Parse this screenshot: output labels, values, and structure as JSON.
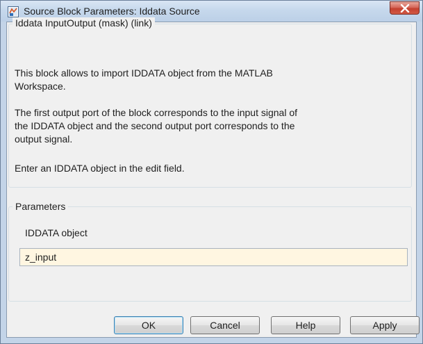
{
  "window": {
    "title": "Source Block Parameters: Iddata Source",
    "icon": "simulink-block-icon",
    "close_icon": "close-icon"
  },
  "description_group": {
    "legend": "Iddata InputOutput (mask) (link)",
    "lines": [
      "This block allows to import IDDATA object from the MATLAB",
      "Workspace.",
      "The first output port of the block corresponds to the input signal of",
      "the IDDATA object and the second output port corresponds to the",
      "output signal.",
      "Enter an IDDATA object in the edit field."
    ]
  },
  "parameters_group": {
    "legend": "Parameters",
    "field_label": "IDDATA object",
    "field_value": "z_input"
  },
  "buttons": {
    "ok": "OK",
    "cancel": "Cancel",
    "help": "Help",
    "apply": "Apply"
  },
  "colors": {
    "input_background": "#fff6e1",
    "close_button": "#c4402f",
    "default_button_border": "#3c7fb1"
  }
}
